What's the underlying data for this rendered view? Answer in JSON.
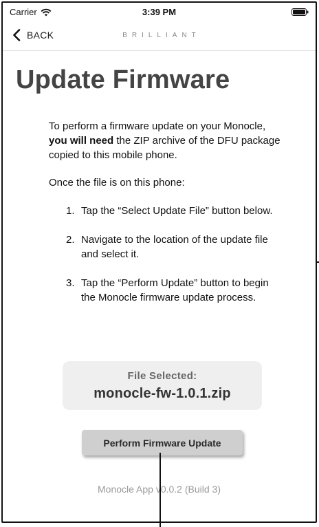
{
  "status_bar": {
    "carrier": "Carrier",
    "time": "3:39 PM",
    "icons": [
      "wifi-icon",
      "battery-icon"
    ]
  },
  "nav": {
    "back_label": "BACK",
    "back_icon": "chevron-left-icon",
    "brand": "BRILLIANT"
  },
  "page": {
    "title": "Update Firmware"
  },
  "instructions": {
    "intro_before": "To perform a firmware update on your Monocle, ",
    "intro_bold": "you will need",
    "intro_after": " the ZIP archive of the DFU package copied to this mobile phone.",
    "lead": "Once the file is on this phone:",
    "steps": [
      {
        "number": "1.",
        "text": "Tap the “Select Update File” button below."
      },
      {
        "number": "2.",
        "text": "Navigate to the location of the update file and select it."
      },
      {
        "number": "3.",
        "text": "Tap the “Perform Update” button to begin the Monocle firmware update process."
      }
    ]
  },
  "file_card": {
    "caption": "File Selected:",
    "filename": "monocle-fw-1.0.1.zip"
  },
  "actions": {
    "perform_label": "Perform Firmware Update"
  },
  "footer": {
    "version": "Monocle App v0.0.2 (Build 3)"
  },
  "colors": {
    "title": "#444444",
    "card_bg": "#efefef",
    "button_bg": "#cfcfcf",
    "muted_text": "#999999"
  }
}
